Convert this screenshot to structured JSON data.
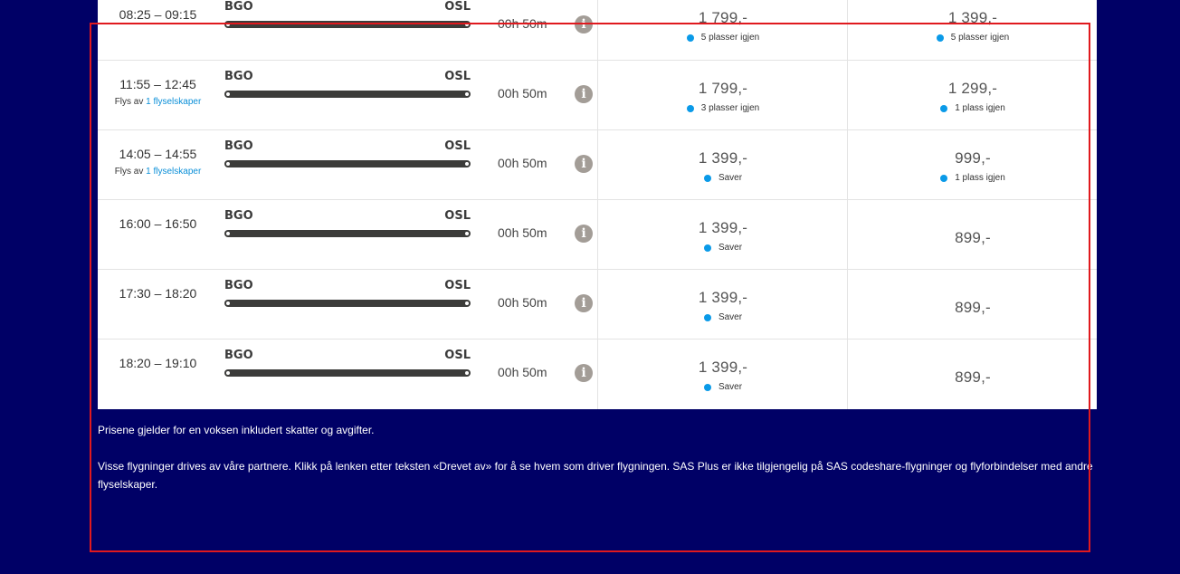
{
  "flights": [
    {
      "time": "08:25 – 09:15",
      "operator_prefix": "",
      "operator_link": "",
      "from": "BGO",
      "to": "OSL",
      "duration": "00h 50m",
      "price1": "1 799,-",
      "avail1": "5 plasser igjen",
      "price2": "1 399,-",
      "avail2": "5 plasser igjen"
    },
    {
      "time": "11:55 – 12:45",
      "operator_prefix": "Flys av",
      "operator_link": "1 flyselskaper",
      "from": "BGO",
      "to": "OSL",
      "duration": "00h 50m",
      "price1": "1 799,-",
      "avail1": "3 plasser igjen",
      "price2": "1 299,-",
      "avail2": "1 plass igjen"
    },
    {
      "time": "14:05 – 14:55",
      "operator_prefix": "Flys av",
      "operator_link": "1 flyselskaper",
      "from": "BGO",
      "to": "OSL",
      "duration": "00h 50m",
      "price1": "1 399,-",
      "avail1": "Saver",
      "price2": "999,-",
      "avail2": "1 plass igjen"
    },
    {
      "time": "16:00 – 16:50",
      "operator_prefix": "",
      "operator_link": "",
      "from": "BGO",
      "to": "OSL",
      "duration": "00h 50m",
      "price1": "1 399,-",
      "avail1": "Saver",
      "price2": "899,-",
      "avail2": ""
    },
    {
      "time": "17:30 – 18:20",
      "operator_prefix": "",
      "operator_link": "",
      "from": "BGO",
      "to": "OSL",
      "duration": "00h 50m",
      "price1": "1 399,-",
      "avail1": "Saver",
      "price2": "899,-",
      "avail2": ""
    },
    {
      "time": "18:20 – 19:10",
      "operator_prefix": "",
      "operator_link": "",
      "from": "BGO",
      "to": "OSL",
      "duration": "00h 50m",
      "price1": "1 399,-",
      "avail1": "Saver",
      "price2": "899,-",
      "avail2": ""
    }
  ],
  "info_icon": "info-icon",
  "notes": {
    "line1": "Prisene gjelder for en voksen inkludert skatter og avgifter.",
    "line2": "Visse flygninger drives av våre partnere. Klikk på lenken etter teksten «Drevet av» for å se hvem som driver flygningen. SAS Plus er ikke tilgjengelig på SAS codeshare-flygninger og flyforbindelser med andre flyselskaper."
  },
  "colors": {
    "background": "#000066",
    "availability_dot": "#0a9ae8",
    "link": "#0a8fd8",
    "highlight_border": "#e0191e"
  }
}
